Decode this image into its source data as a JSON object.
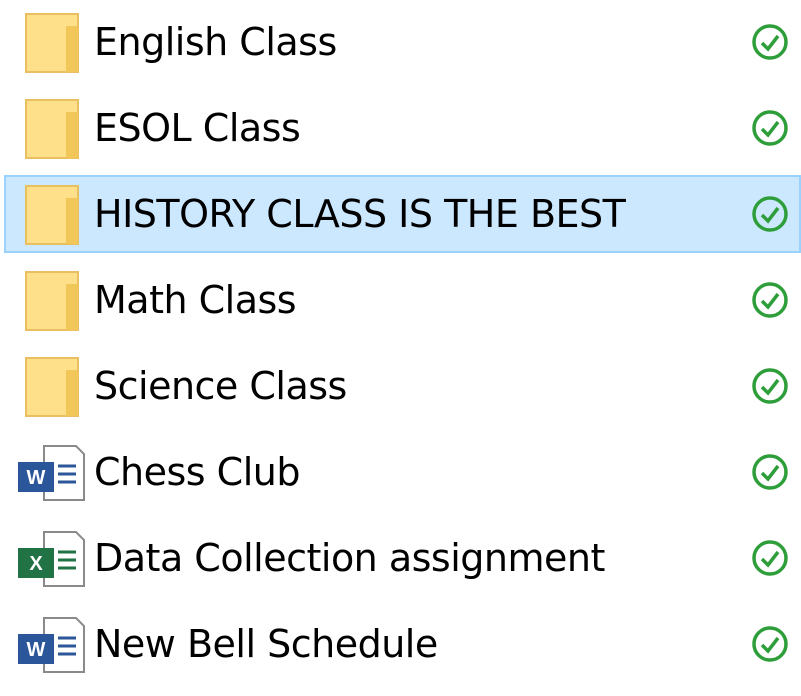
{
  "colors": {
    "folder_fill": "#ffe08a",
    "folder_edge": "#e0b040",
    "status_green": "#2e9e3a",
    "selection_fill": "#cce8ff",
    "selection_border": "#99d1ff",
    "word_blue": "#2b579a",
    "excel_green": "#217346"
  },
  "items": [
    {
      "name": "English Class",
      "type": "folder",
      "icon": "folder-icon",
      "status": "synced-check-icon",
      "selected": false
    },
    {
      "name": "ESOL Class",
      "type": "folder",
      "icon": "folder-icon",
      "status": "synced-check-icon",
      "selected": false
    },
    {
      "name": "HISTORY CLASS IS THE BEST",
      "type": "folder",
      "icon": "folder-icon",
      "status": "synced-check-icon",
      "selected": true
    },
    {
      "name": "Math Class",
      "type": "folder",
      "icon": "folder-icon",
      "status": "synced-check-icon",
      "selected": false
    },
    {
      "name": "Science Class",
      "type": "folder",
      "icon": "folder-icon",
      "status": "synced-check-icon",
      "selected": false
    },
    {
      "name": "Chess Club",
      "type": "word",
      "icon": "word-document-icon",
      "status": "synced-check-icon",
      "selected": false
    },
    {
      "name": "Data Collection assignment",
      "type": "excel",
      "icon": "excel-document-icon",
      "status": "synced-check-icon",
      "selected": false
    },
    {
      "name": "New Bell Schedule",
      "type": "word",
      "icon": "word-document-icon",
      "status": "synced-check-icon",
      "selected": false
    }
  ]
}
